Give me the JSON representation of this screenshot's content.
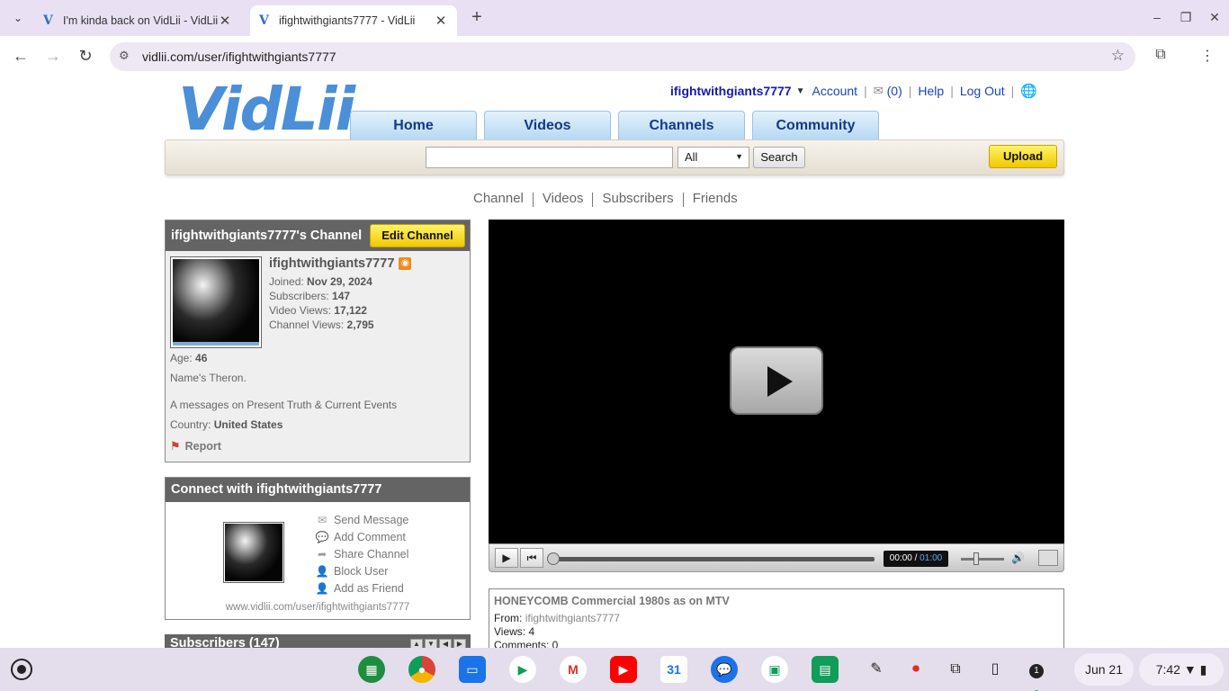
{
  "browser": {
    "tabs": [
      {
        "title": "I'm kinda back on VidLii - VidLii",
        "favicon": "V"
      },
      {
        "title": "ifightwithgiants7777 - VidLii",
        "favicon": "V"
      }
    ],
    "url": "vidlii.com/user/ifightwithgiants7777"
  },
  "site": {
    "logo": "VidLii",
    "username": "ifightwithgiants7777",
    "links": {
      "account": "Account",
      "messages": "(0)",
      "help": "Help",
      "logout": "Log Out"
    },
    "nav": [
      "Home",
      "Videos",
      "Channels",
      "Community"
    ],
    "search": {
      "placeholder": "",
      "filter": "All",
      "button": "Search"
    },
    "upload": "Upload",
    "subnav": [
      "Channel",
      "Videos",
      "Subscribers",
      "Friends"
    ]
  },
  "channel": {
    "header": "ifightwithgiants7777's Channel",
    "edit": "Edit Channel",
    "name": "ifightwithgiants7777",
    "joined_label": "Joined:",
    "joined": "Nov 29, 2024",
    "subs_label": "Subscribers:",
    "subs": "147",
    "vviews_label": "Video Views:",
    "vviews": "17,122",
    "cviews_label": "Channel Views:",
    "cviews": "2,795",
    "age_label": "Age:",
    "age": "46",
    "about": "Name's Theron.",
    "desc": "A messages on Present Truth & Current Events",
    "country_label": "Country:",
    "country": "United States",
    "report": "Report"
  },
  "connect": {
    "header": "Connect with ifightwithgiants7777",
    "actions": [
      "Send Message",
      "Add Comment",
      "Share Channel",
      "Block User",
      "Add as Friend"
    ],
    "url": "www.vidlii.com/user/ifightwithgiants7777"
  },
  "subscribers_box": {
    "header": "Subscribers (147)"
  },
  "player": {
    "current": "00:00",
    "sep": " / ",
    "duration": "01:00"
  },
  "video": {
    "title": "HONEYCOMB Commercial 1980s as on MTV",
    "from_label": "From:",
    "from": "ifightwithgiants7777",
    "views": "Views: 4",
    "comments": "Comments: 0"
  },
  "shelf": {
    "date": "Jun 21",
    "time": "7:42",
    "notif": "1"
  },
  "colors": {
    "accent_yellow": "#f0c800",
    "nav_blue": "#0f3a8a",
    "box_header": "#646464"
  }
}
